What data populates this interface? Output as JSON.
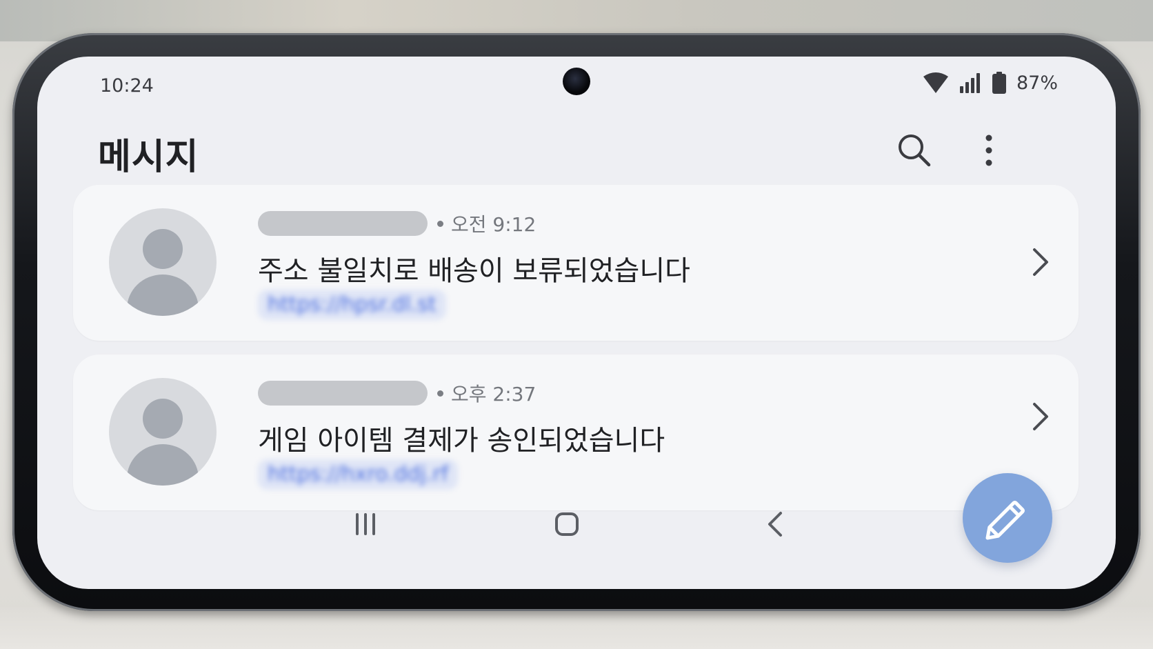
{
  "status_bar": {
    "time": "10:24",
    "battery_percent": "87%",
    "icons": [
      "wifi-icon",
      "signal-icon",
      "battery-icon"
    ]
  },
  "header": {
    "title": "메시지",
    "icons": [
      "search-icon",
      "more-vert-icon"
    ]
  },
  "messages": [
    {
      "time": "오전 9:12",
      "text": "주소 불일치로 배송이 보류되었습니다",
      "link": "https://hpsr.dl.st",
      "avatar_icon": "person-icon"
    },
    {
      "time": "오후 2:37",
      "text": "게임 아이템 결제가 송인되었습니다",
      "link": "https://hxro.ddj.rf",
      "avatar_icon": "person-icon"
    }
  ],
  "fab": {
    "icon": "edit-icon"
  },
  "nav_bar": {
    "icons": [
      "recents-icon",
      "home-icon",
      "back-icon"
    ]
  },
  "colors": {
    "screen_bg": "#eeeff3",
    "card_bg": "#f6f7f9",
    "fab": "#82a5dc",
    "link": "#4b6ee0",
    "avatar": "#a5aab2"
  }
}
